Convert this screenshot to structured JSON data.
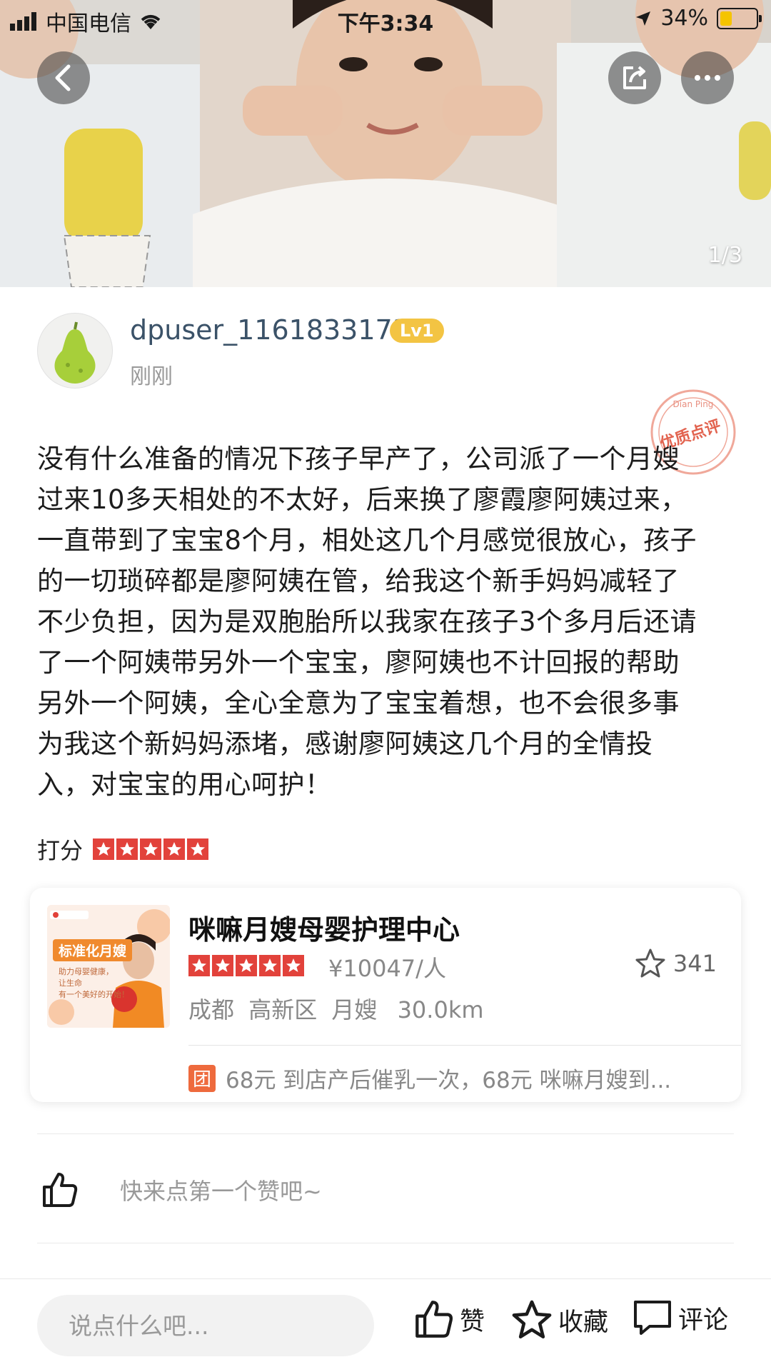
{
  "status_bar": {
    "carrier": "中国电信",
    "time": "下午3:34",
    "battery": "34%",
    "battery_level": 0.34
  },
  "header": {
    "back_icon": "chevron-left-icon",
    "share_icon": "share-icon",
    "more_icon": "more-icon",
    "photo_index": "1/3"
  },
  "user": {
    "name": "dpuser_1161833173",
    "level": "Lv1",
    "time": "刚刚",
    "avatar_icon": "pear-avatar"
  },
  "seal": {
    "main": "优质点评",
    "sub": "Dian Ping"
  },
  "review": {
    "text": "没有什么准备的情况下孩子早产了，公司派了一个月嫂\n过来10多天相处的不太好，后来换了廖霞廖阿姨过来，\n一直带到了宝宝8个月，相处这几个月感觉很放心，孩子\n的一切琐碎都是廖阿姨在管，给我这个新手妈妈减轻了\n不少负担，因为是双胞胎所以我家在孩子3个多月后还请\n了一个阿姨带另外一个宝宝，廖阿姨也不计回报的帮助\n另外一个阿姨，全心全意为了宝宝着想，也不会很多事\n为我这个新妈妈添堵，感谢廖阿姨这几个月的全情投\n入，对宝宝的用心呵护！"
  },
  "score": {
    "label": "打分",
    "stars": 5
  },
  "shop": {
    "image_tag": "标准化月嫂",
    "image_text": "助力母婴健康，\n让生命\n有一个美好的开始！",
    "name": "咪嘛月嫂母婴护理中心",
    "stars": 5,
    "price": "¥10047/人",
    "favorites": "341",
    "city": "成都",
    "district": "高新区",
    "category": "月嫂",
    "distance": "30.0km",
    "deal_badge": "团",
    "deal_text": "68元 到店产后催乳一次，68元 咪嘛月嫂到..."
  },
  "like_row": {
    "text": "快来点第一个赞吧~"
  },
  "bottom_bar": {
    "input_placeholder": "说点什么吧...",
    "like_label": "赞",
    "favorite_label": "收藏",
    "comment_label": "评论"
  },
  "colors": {
    "star_red": "#e2423b",
    "level_badge": "#f3c443",
    "deal_orange": "#ee6a3d",
    "username_blue": "#3b5268"
  }
}
